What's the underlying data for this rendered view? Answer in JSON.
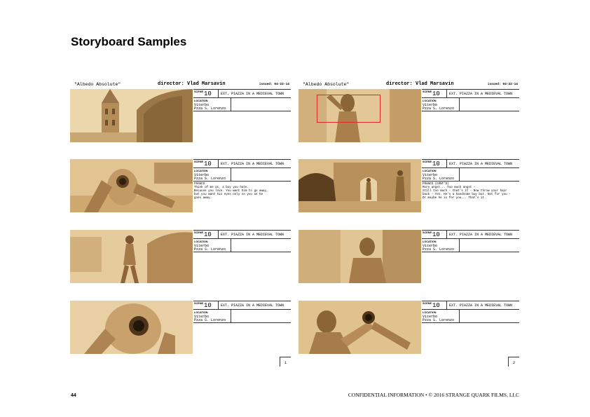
{
  "page": {
    "title": "Storyboard Samples",
    "number": "44",
    "confidential": "CONFIDENTIAL INFORMATION • © 2016 STRANGE QUARK FILMS, LLC"
  },
  "sheets": [
    {
      "film_title": "\"Albedo Absolute\"",
      "director": "director: Vlad Marsavin",
      "issued": "issued: 04-22-14",
      "page_number": "1",
      "panels": [
        {
          "scene_label": "SCENE",
          "scene": "10",
          "desc": "EXT. PIAZZA IN A MEDIEVAL TOWN",
          "loc_label": "LOCATION",
          "loc1": "Viterbo",
          "loc2": "Pzza S. Lorenzo",
          "dialogue": "",
          "icon": "bell-tower-image"
        },
        {
          "scene_label": "SCENE",
          "scene": "10",
          "desc": "EXT. PIAZZA IN A MEDIEVAL TOWN",
          "loc_label": "LOCATION",
          "loc1": "Viterbo",
          "loc2": "Pzza S. Lorenzo",
          "dialogue": "FRANCO\nThink of me as, a boy you hate.\nBecause you love. You want him to go away,\nbut you want his eyes only on you as he\ngoes away.",
          "icon": "photographer-image"
        },
        {
          "scene_label": "SCENE",
          "scene": "10",
          "desc": "EXT. PIAZZA IN A MEDIEVAL TOWN",
          "loc_label": "LOCATION",
          "loc1": "Viterbo",
          "loc2": "Pzza S. Lorenzo",
          "dialogue": "",
          "icon": "model-pose-image"
        },
        {
          "scene_label": "SCENE",
          "scene": "10",
          "desc": "EXT. PIAZZA IN A MEDIEVAL TOWN",
          "loc_label": "LOCATION",
          "loc1": "Viterbo",
          "loc2": "Pzza S. Lorenzo",
          "dialogue": "",
          "icon": "camera-closeup-image"
        }
      ]
    },
    {
      "film_title": "\"Albedo Absolute\"",
      "director": "director: Vlad Marsavin",
      "issued": "issued: 04-22-14",
      "page_number": "2",
      "panels": [
        {
          "scene_label": "SCENE",
          "scene": "10",
          "desc": "EXT. PIAZZA IN A MEDIEVAL TOWN",
          "loc_label": "LOCATION",
          "loc1": "Viterbo",
          "loc2": "Pzza S. Lorenzo",
          "dialogue": "",
          "icon": "woman-portrait-image"
        },
        {
          "scene_label": "SCENE",
          "scene": "10",
          "desc": "EXT. PIAZZA IN A MEDIEVAL TOWN",
          "loc_label": "LOCATION",
          "loc1": "Viterbo",
          "loc2": "Pzza S. Lorenzo",
          "dialogue": "FRANCO (CONT'D)\nMore angst... Too much angst -\nStill too much - that's it - Now throw your hair\nback - Yes. He's a handsome boy but. Not for you -\nOr maybe he is for you... That's it.",
          "icon": "piazza-scene-image"
        },
        {
          "scene_label": "SCENE",
          "scene": "10",
          "desc": "EXT. PIAZZA IN A MEDIEVAL TOWN",
          "loc_label": "LOCATION",
          "loc1": "Viterbo",
          "loc2": "Pzza S. Lorenzo",
          "dialogue": "",
          "icon": "man-portrait-image"
        },
        {
          "scene_label": "SCENE",
          "scene": "10",
          "desc": "EXT. PIAZZA IN A MEDIEVAL TOWN",
          "loc_label": "LOCATION",
          "loc1": "Viterbo",
          "loc2": "Pzza S. Lorenzo",
          "dialogue": "",
          "icon": "camera-handoff-image"
        }
      ]
    }
  ],
  "colors": {
    "sepia_light": "#e9cfa0",
    "sepia_dark": "#8a6a3c",
    "highlight": "#e0282c"
  }
}
